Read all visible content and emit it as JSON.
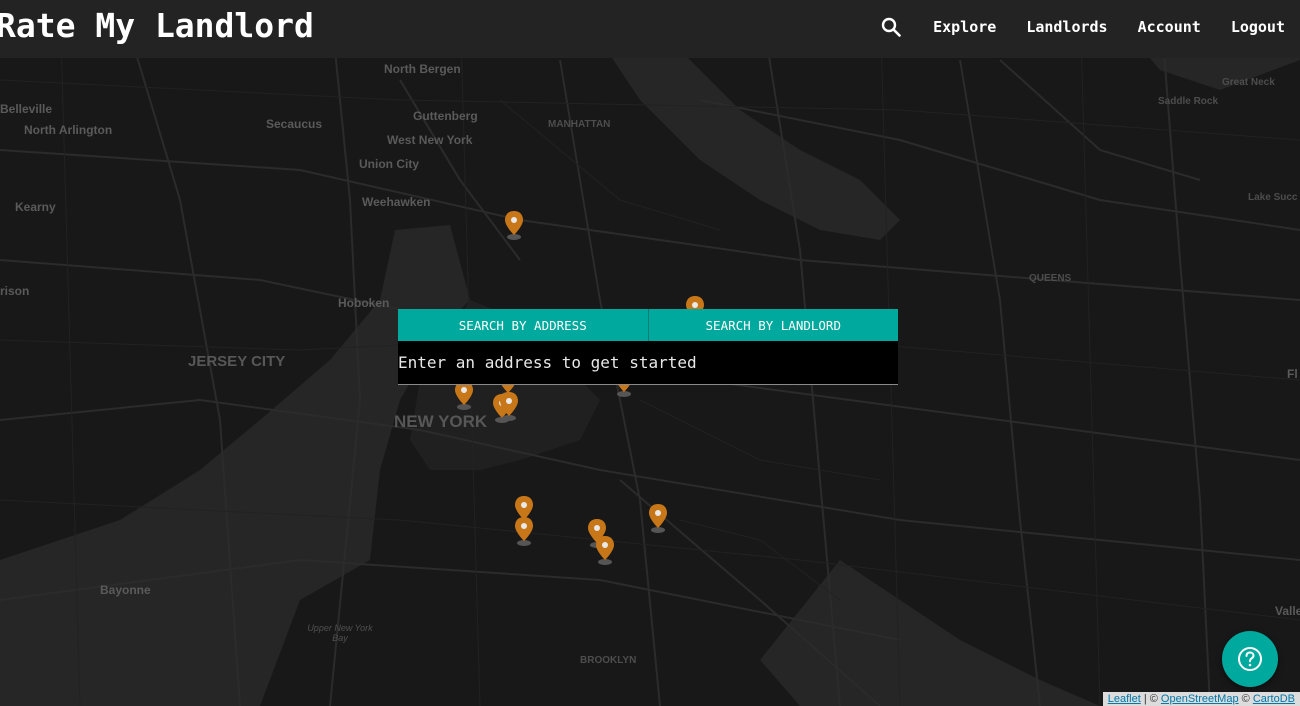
{
  "header": {
    "brand": "Rate My Landlord",
    "nav": [
      "Explore",
      "Landlords",
      "Account",
      "Logout"
    ]
  },
  "search": {
    "tab_address": "SEARCH BY ADDRESS",
    "tab_landlord": "SEARCH BY LANDLORD",
    "placeholder": "Enter an address to get started"
  },
  "map": {
    "labels": [
      "North Bergen",
      "Guttenberg",
      "MANHATTAN",
      "Belleville",
      "North Arlington",
      "Secaucus",
      "West New York",
      "Union City",
      "Weehawken",
      "Kearny",
      "rison",
      "Hoboken",
      "JERSEY CITY",
      "NEW YORK",
      "QUEENS",
      "Great Neck",
      "Saddle Rock",
      "Lake Succ",
      "Fl",
      "Bayonne",
      "Upper New York Bay",
      "BROOKLYN",
      "Valle"
    ],
    "marker_color": "#c77618"
  },
  "attribution": {
    "leaflet": "Leaflet",
    "separator": "| ©",
    "osm": "OpenStreetMap",
    "copy": "©",
    "carto": "CartoDB"
  },
  "colors": {
    "accent": "#00a99d",
    "header_bg": "#232323"
  }
}
